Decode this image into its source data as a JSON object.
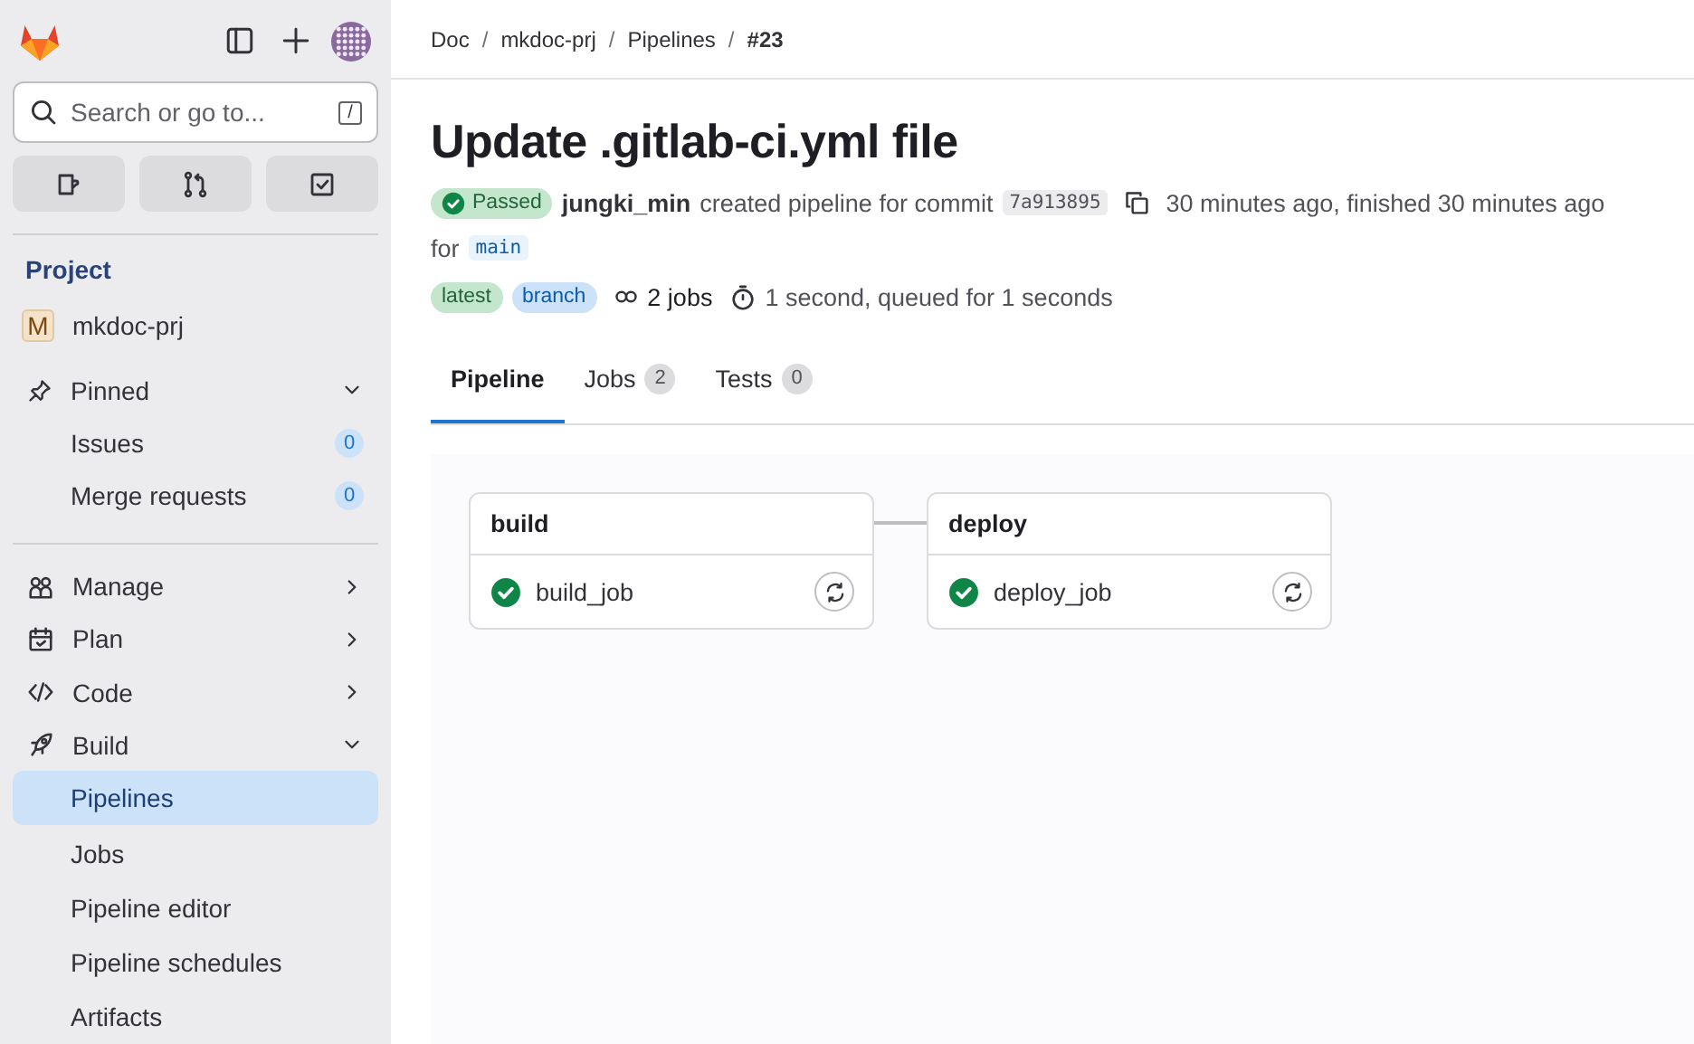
{
  "sidebar": {
    "search": {
      "placeholder": "Search or go to...",
      "shortcut": "/"
    },
    "section_title": "Project",
    "project": {
      "initial": "M",
      "name": "mkdoc-prj"
    },
    "pinned": {
      "label": "Pinned",
      "expanded": true,
      "items": [
        {
          "label": "Issues",
          "count": "0"
        },
        {
          "label": "Merge requests",
          "count": "0"
        }
      ]
    },
    "nav": [
      {
        "label": "Manage",
        "expanded": false
      },
      {
        "label": "Plan",
        "expanded": false
      },
      {
        "label": "Code",
        "expanded": false
      },
      {
        "label": "Build",
        "expanded": true,
        "children": [
          {
            "label": "Pipelines",
            "selected": true
          },
          {
            "label": "Jobs",
            "selected": false
          },
          {
            "label": "Pipeline editor",
            "selected": false
          },
          {
            "label": "Pipeline schedules",
            "selected": false
          },
          {
            "label": "Artifacts",
            "selected": false
          }
        ]
      }
    ]
  },
  "breadcrumb": [
    {
      "kind": "link",
      "text": "Doc"
    },
    {
      "kind": "separator",
      "text": "/"
    },
    {
      "kind": "link",
      "text": "mkdoc-prj"
    },
    {
      "kind": "separator",
      "text": "/"
    },
    {
      "kind": "link",
      "text": "Pipelines"
    },
    {
      "kind": "separator",
      "text": "/"
    },
    {
      "kind": "current",
      "text": "#23"
    }
  ],
  "title": "Update .gitlab-ci.yml file",
  "pipeline": {
    "status": "Passed",
    "author": "jungki_min",
    "action": "created pipeline for commit",
    "commit": "7a913895",
    "time": "30 minutes ago, finished 30 minutes ago",
    "ref_prefix": "for",
    "ref": "main",
    "tags": [
      {
        "label": "latest",
        "kind": "success"
      },
      {
        "label": "branch",
        "kind": "info"
      }
    ],
    "jobs": "2 jobs",
    "duration": "1 second, queued for 1 seconds"
  },
  "tabs": [
    {
      "label": "Pipeline",
      "selected": true
    },
    {
      "label": "Jobs",
      "count": "2",
      "selected": false
    },
    {
      "label": "Tests",
      "count": "0",
      "selected": false
    }
  ],
  "stages": [
    {
      "name": "build",
      "jobs": [
        {
          "name": "build_job",
          "kind": "success"
        }
      ]
    },
    {
      "name": "deploy",
      "jobs": [
        {
          "name": "deploy_job",
          "kind": "success"
        }
      ]
    }
  ]
}
